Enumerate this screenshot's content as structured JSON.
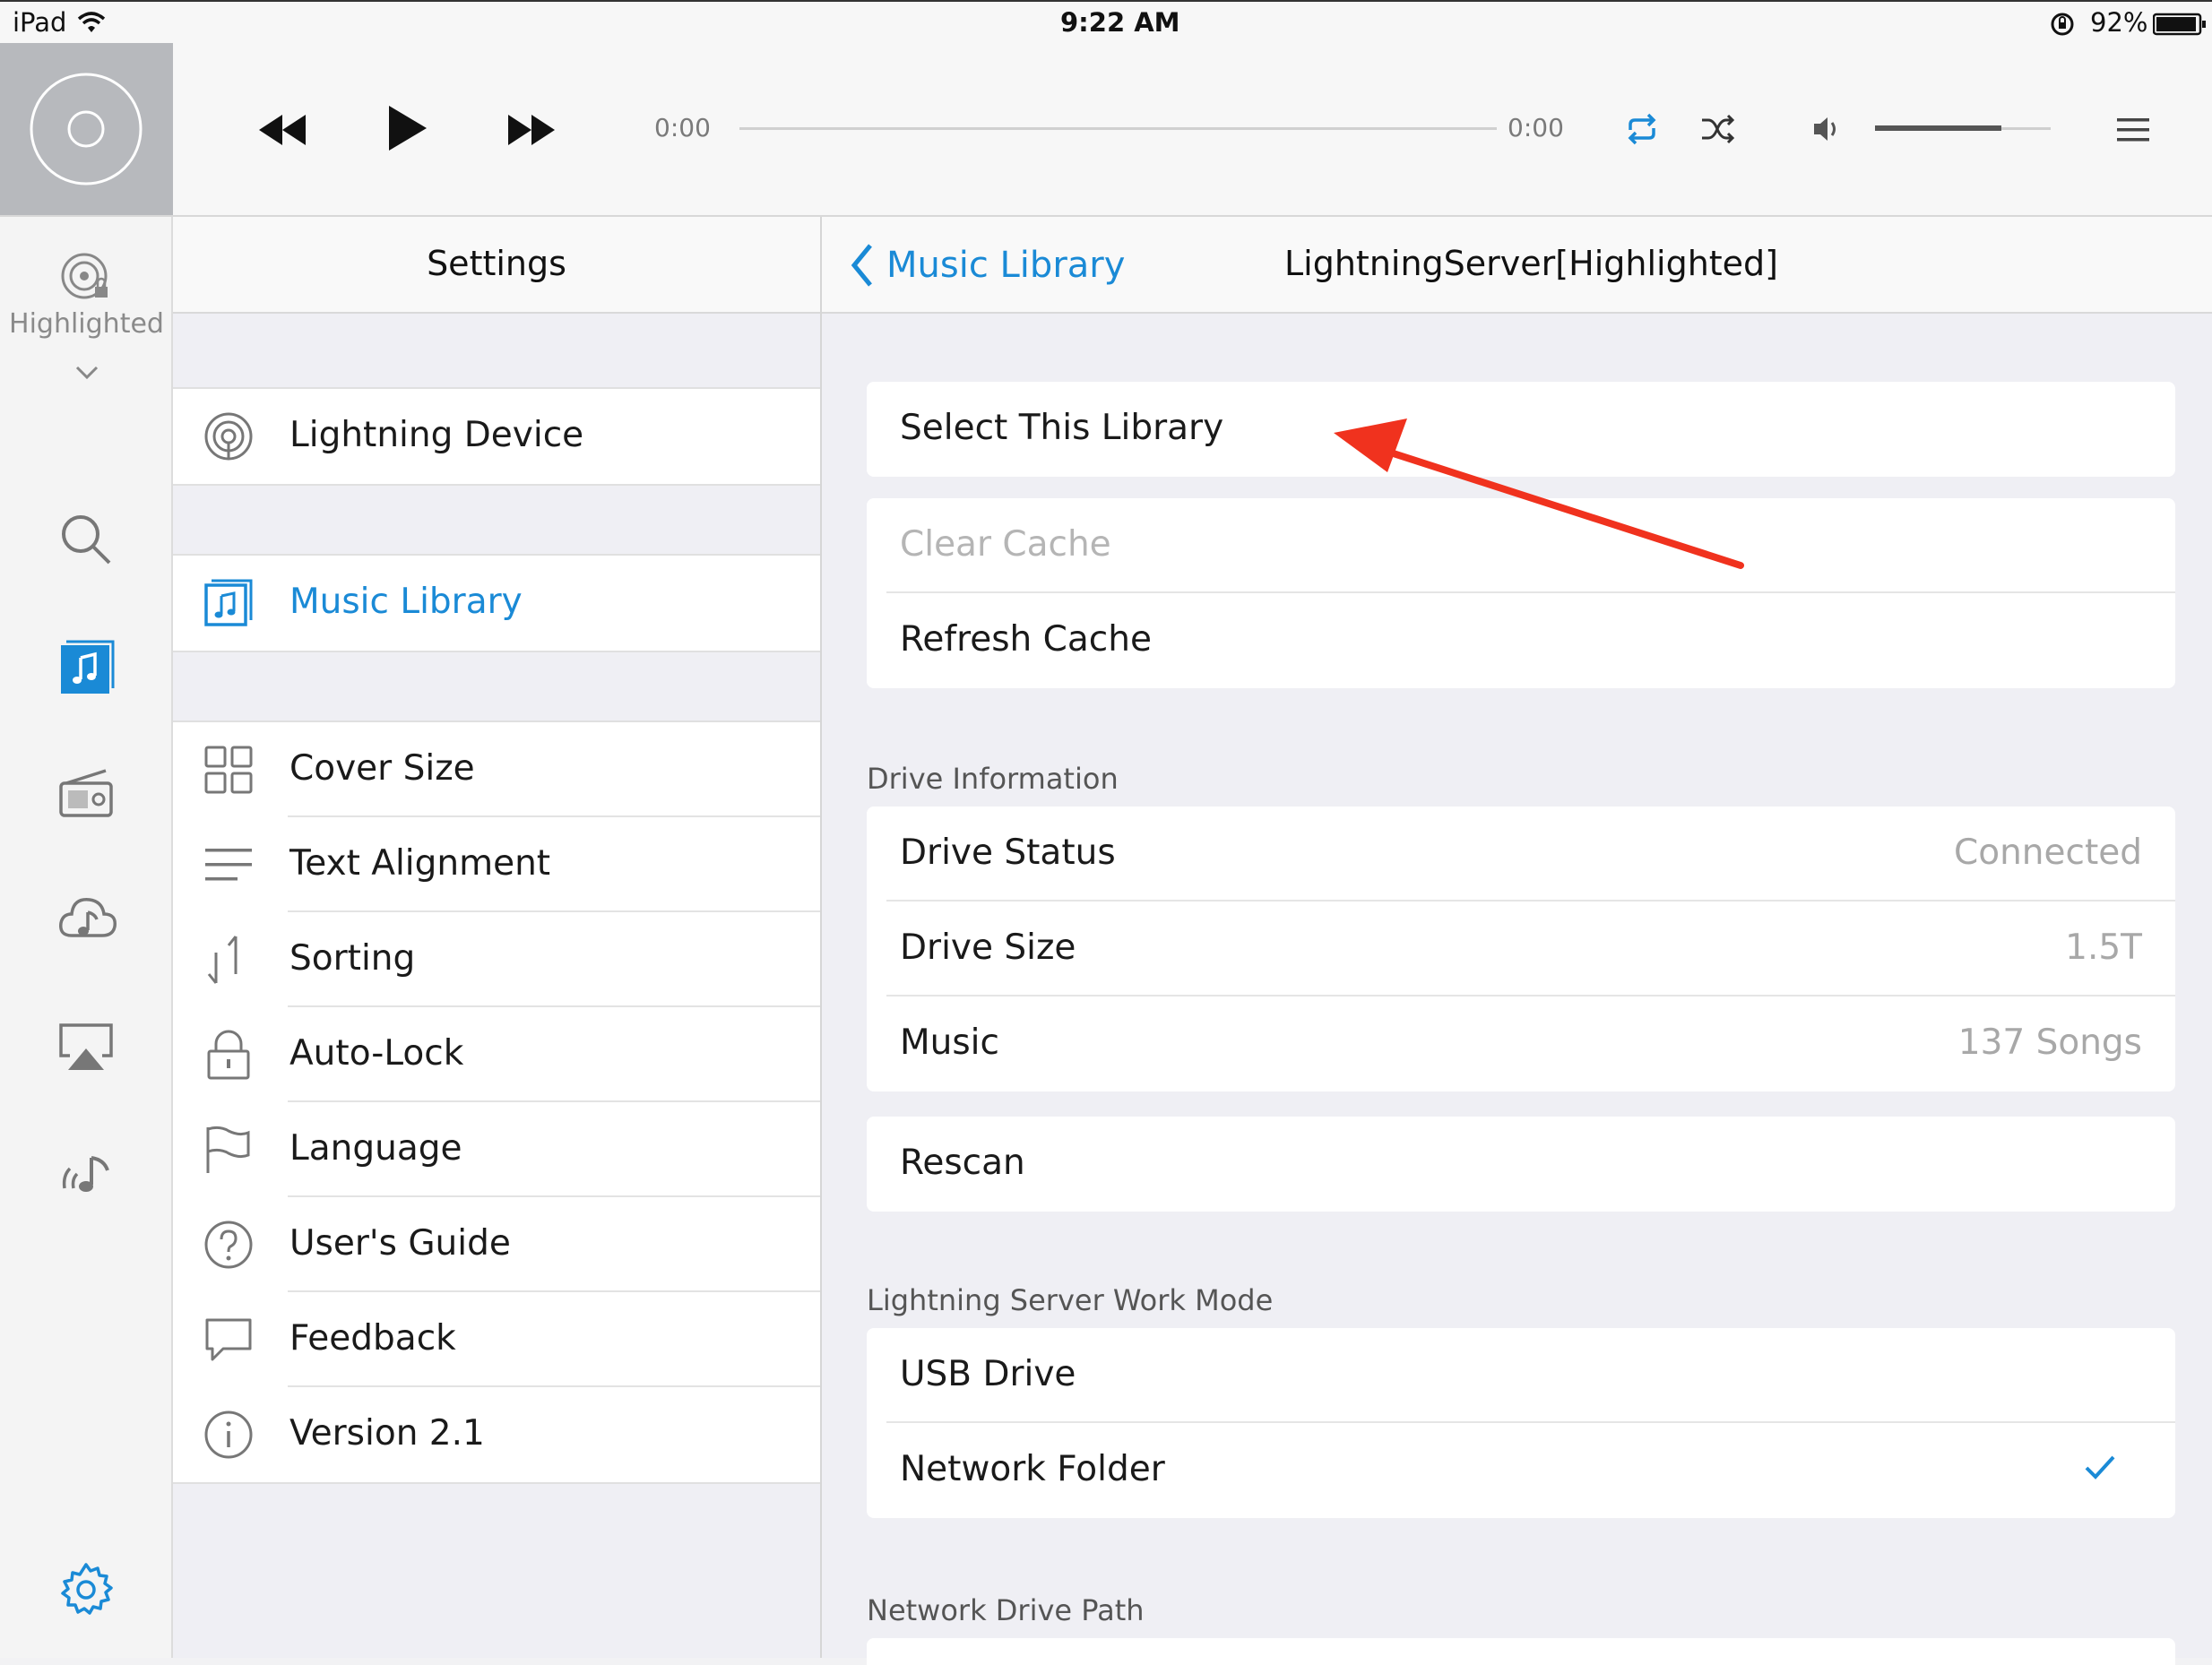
{
  "status_bar": {
    "device": "iPad",
    "time": "9:22 AM",
    "battery": "92%"
  },
  "player": {
    "elapsed": "0:00",
    "remaining": "0:00",
    "volume_level": 0.72,
    "progress_level": 0.0,
    "accent_color": "#1a8ad6"
  },
  "rail": {
    "device_label": "Highlighted",
    "items": [
      "search-icon",
      "music-library-icon",
      "radio-icon",
      "cloud-music-icon",
      "airplay-icon",
      "wireless-music-icon",
      "gear-icon"
    ],
    "active": "music-library-icon"
  },
  "settings": {
    "title": "Settings",
    "groups": [
      [
        {
          "label": "Lightning Device",
          "icon": "lightning-device-icon"
        }
      ],
      [
        {
          "label": "Music Library",
          "icon": "music-library-icon",
          "active": true
        }
      ],
      [
        {
          "label": "Cover Size",
          "icon": "cover-size-grid-icon"
        },
        {
          "label": "Text Alignment",
          "icon": "text-alignment-icon"
        },
        {
          "label": "Sorting",
          "icon": "sorting-icon"
        },
        {
          "label": "Auto-Lock",
          "icon": "lock-icon"
        },
        {
          "label": "Language",
          "icon": "flag-icon"
        },
        {
          "label": "User's Guide",
          "icon": "question-icon"
        },
        {
          "label": "Feedback",
          "icon": "speech-bubble-icon"
        },
        {
          "label": "Version 2.1",
          "icon": "info-icon"
        }
      ]
    ]
  },
  "detail": {
    "back_label": "Music Library",
    "title": "LightningServer[Highlighted]",
    "select_library": "Select This Library",
    "cache": {
      "clear": "Clear Cache",
      "refresh": "Refresh Cache"
    },
    "drive_info": {
      "heading": "Drive Information",
      "rows": [
        {
          "label": "Drive Status",
          "value": "Connected"
        },
        {
          "label": "Drive Size",
          "value": "1.5T"
        },
        {
          "label": "Music",
          "value": "137 Songs"
        }
      ]
    },
    "rescan": "Rescan",
    "work_mode": {
      "heading": "Lightning Server Work Mode",
      "options": [
        {
          "label": "USB Drive",
          "selected": false
        },
        {
          "label": "Network Folder",
          "selected": true
        }
      ]
    },
    "network_path": {
      "heading": "Network Drive Path"
    },
    "annotation_color": "#f0321e"
  }
}
